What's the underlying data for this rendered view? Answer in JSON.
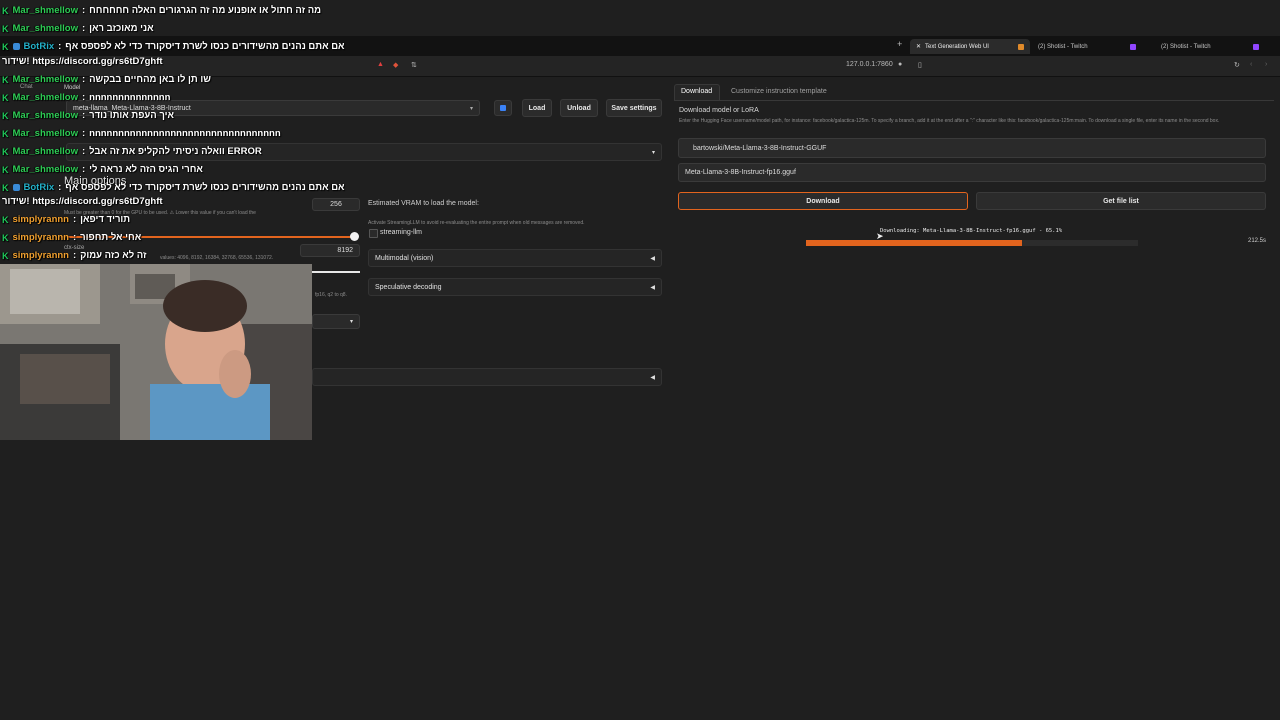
{
  "browser": {
    "tabs": [
      {
        "label": "Text Generation Web UI",
        "active": true
      },
      {
        "label": "(2) Shotist - Twitch",
        "active": false
      },
      {
        "label": "(2) Shotist - Twitch",
        "active": false
      }
    ],
    "address": "127.0.0.1:7860"
  },
  "left": {
    "nav_chat": "Chat",
    "model_label": "Model",
    "model_value": "meta-llama_Meta-Llama-3-8B-Instruct",
    "load": "Load",
    "unload": "Unload",
    "save_settings": "Save settings",
    "main_options": "Main options",
    "gpu_layers_value": "256",
    "gpu_note": "Must be greater than 0 for the GPU to be used. ⚠ Lower this value if you can't load the",
    "ctx_size_label": "ctx-size",
    "ctx_size_value": "8192",
    "ctx_note": "values: 4096, 8192, 16384, 32768, 65536, 131072.",
    "cache_note": "fp16, q2 to q8.",
    "vram_label": "Estimated VRAM to load the model:",
    "streaming_note": "Activate StreamingLLM to avoid re-evaluating the entire prompt when old messages are removed.",
    "streaming_label": "streaming-llm",
    "multimodal": "Multimodal (vision)",
    "speculative": "Speculative decoding"
  },
  "right": {
    "tab_download": "Download",
    "tab_customize": "Customize instruction template",
    "section_title": "Download model or LoRA",
    "help": "Enter the Hugging Face username/model path, for instance: facebook/galactica-125m. To specify a branch, add it at the end after a \":\" character like this: facebook/galactica-125m:main. To download a single file, enter its name in the second box.",
    "repo_value": "bartowski/Meta-Llama-3-8B-Instruct-GGUF",
    "file_value": "Meta-Llama-3-8B-Instruct-fp16.gguf",
    "download_button": "Download",
    "file_list_button": "Get file list",
    "progress_text": "Downloading: Meta-Llama-3-8B-Instruct-fp16.gguf - 65.1%",
    "progress": 0.651,
    "elapsed": "212.5s"
  },
  "chat": [
    {
      "user": "Mar_shmellow",
      "msg": "מה זה חתול או אופנוע מה זה הגרגורים האלה חחחחחח",
      "color": "green"
    },
    {
      "user": "Mar_shmellow",
      "msg": "אני מאוכזב ראן",
      "color": "green"
    },
    {
      "user": "BotRix",
      "msg": "אם אתם נהנים מהשידורים כנסו לשרת דיסקורד כדי לא לפספס אף",
      "color": "bot"
    },
    {
      "user": "",
      "msg": "שידור! https://discord.gg/rs6tD7ghft",
      "color": "none"
    },
    {
      "user": "Mar_shmellow",
      "msg": "שו תן לו באן מהחיים בבקשה",
      "color": "green"
    },
    {
      "user": "Mar_shmellow",
      "msg": "nnnnnnnnnnnnnn",
      "color": "green"
    },
    {
      "user": "Mar_shmellow",
      "msg": "איך העפת אותו נודר",
      "color": "green"
    },
    {
      "user": "Mar_shmellow",
      "msg": "nnnnnnnnnnnnnnnnnnnnnnnnnnnnnnnnn",
      "color": "green"
    },
    {
      "user": "Mar_shmellow",
      "msg": "וואלה ניסיתי להקליפ את זה אבל ERROR",
      "color": "green"
    },
    {
      "user": "Mar_shmellow",
      "msg": "אחרי הגיס הזה לא נראה לי",
      "color": "green"
    },
    {
      "user": "BotRix",
      "msg": "אם אתם נהנים מהשידורים כנסו לשרת דיסקורד כדי לא לפספס אף",
      "color": "bot"
    },
    {
      "user": "",
      "msg": "שידור! https://discord.gg/rs6tD7ghft",
      "color": "none"
    },
    {
      "user": "simplyrannn",
      "msg": "תוריד דיפאן",
      "color": "orange"
    },
    {
      "user": "simplyrannn",
      "msg": "אחי אל תחפור",
      "color": "orange"
    },
    {
      "user": "simplyrannn",
      "msg": "זה לא כזה עמוק",
      "color": "orange"
    }
  ],
  "colors": {
    "accent": "#e2641e",
    "background": "#1f1f1f"
  }
}
